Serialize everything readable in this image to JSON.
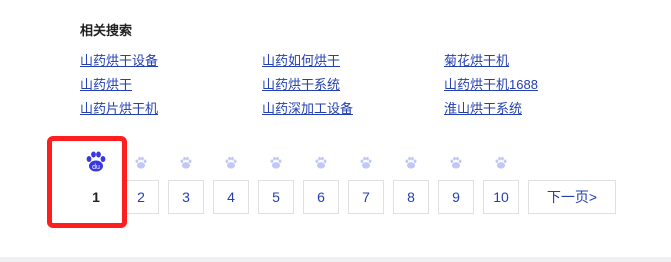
{
  "related": {
    "title": "相关搜索",
    "links": [
      "山药烘干设备",
      "山药如何烘干",
      "菊花烘干机",
      "山药烘干",
      "山药烘干系统",
      "山药烘干机1688",
      "山药片烘干机",
      "山药深加工设备",
      "淮山烘干系统"
    ]
  },
  "pagination": {
    "current": "1",
    "pages": [
      "1",
      "2",
      "3",
      "4",
      "5",
      "6",
      "7",
      "8",
      "9",
      "10"
    ],
    "next_label": "下一页>",
    "paw_text": "du"
  },
  "colors": {
    "link": "#2440b3",
    "highlight": "#ff1e1e",
    "paw_active": "#3838e0",
    "paw_inactive": "#c2c8f5"
  }
}
